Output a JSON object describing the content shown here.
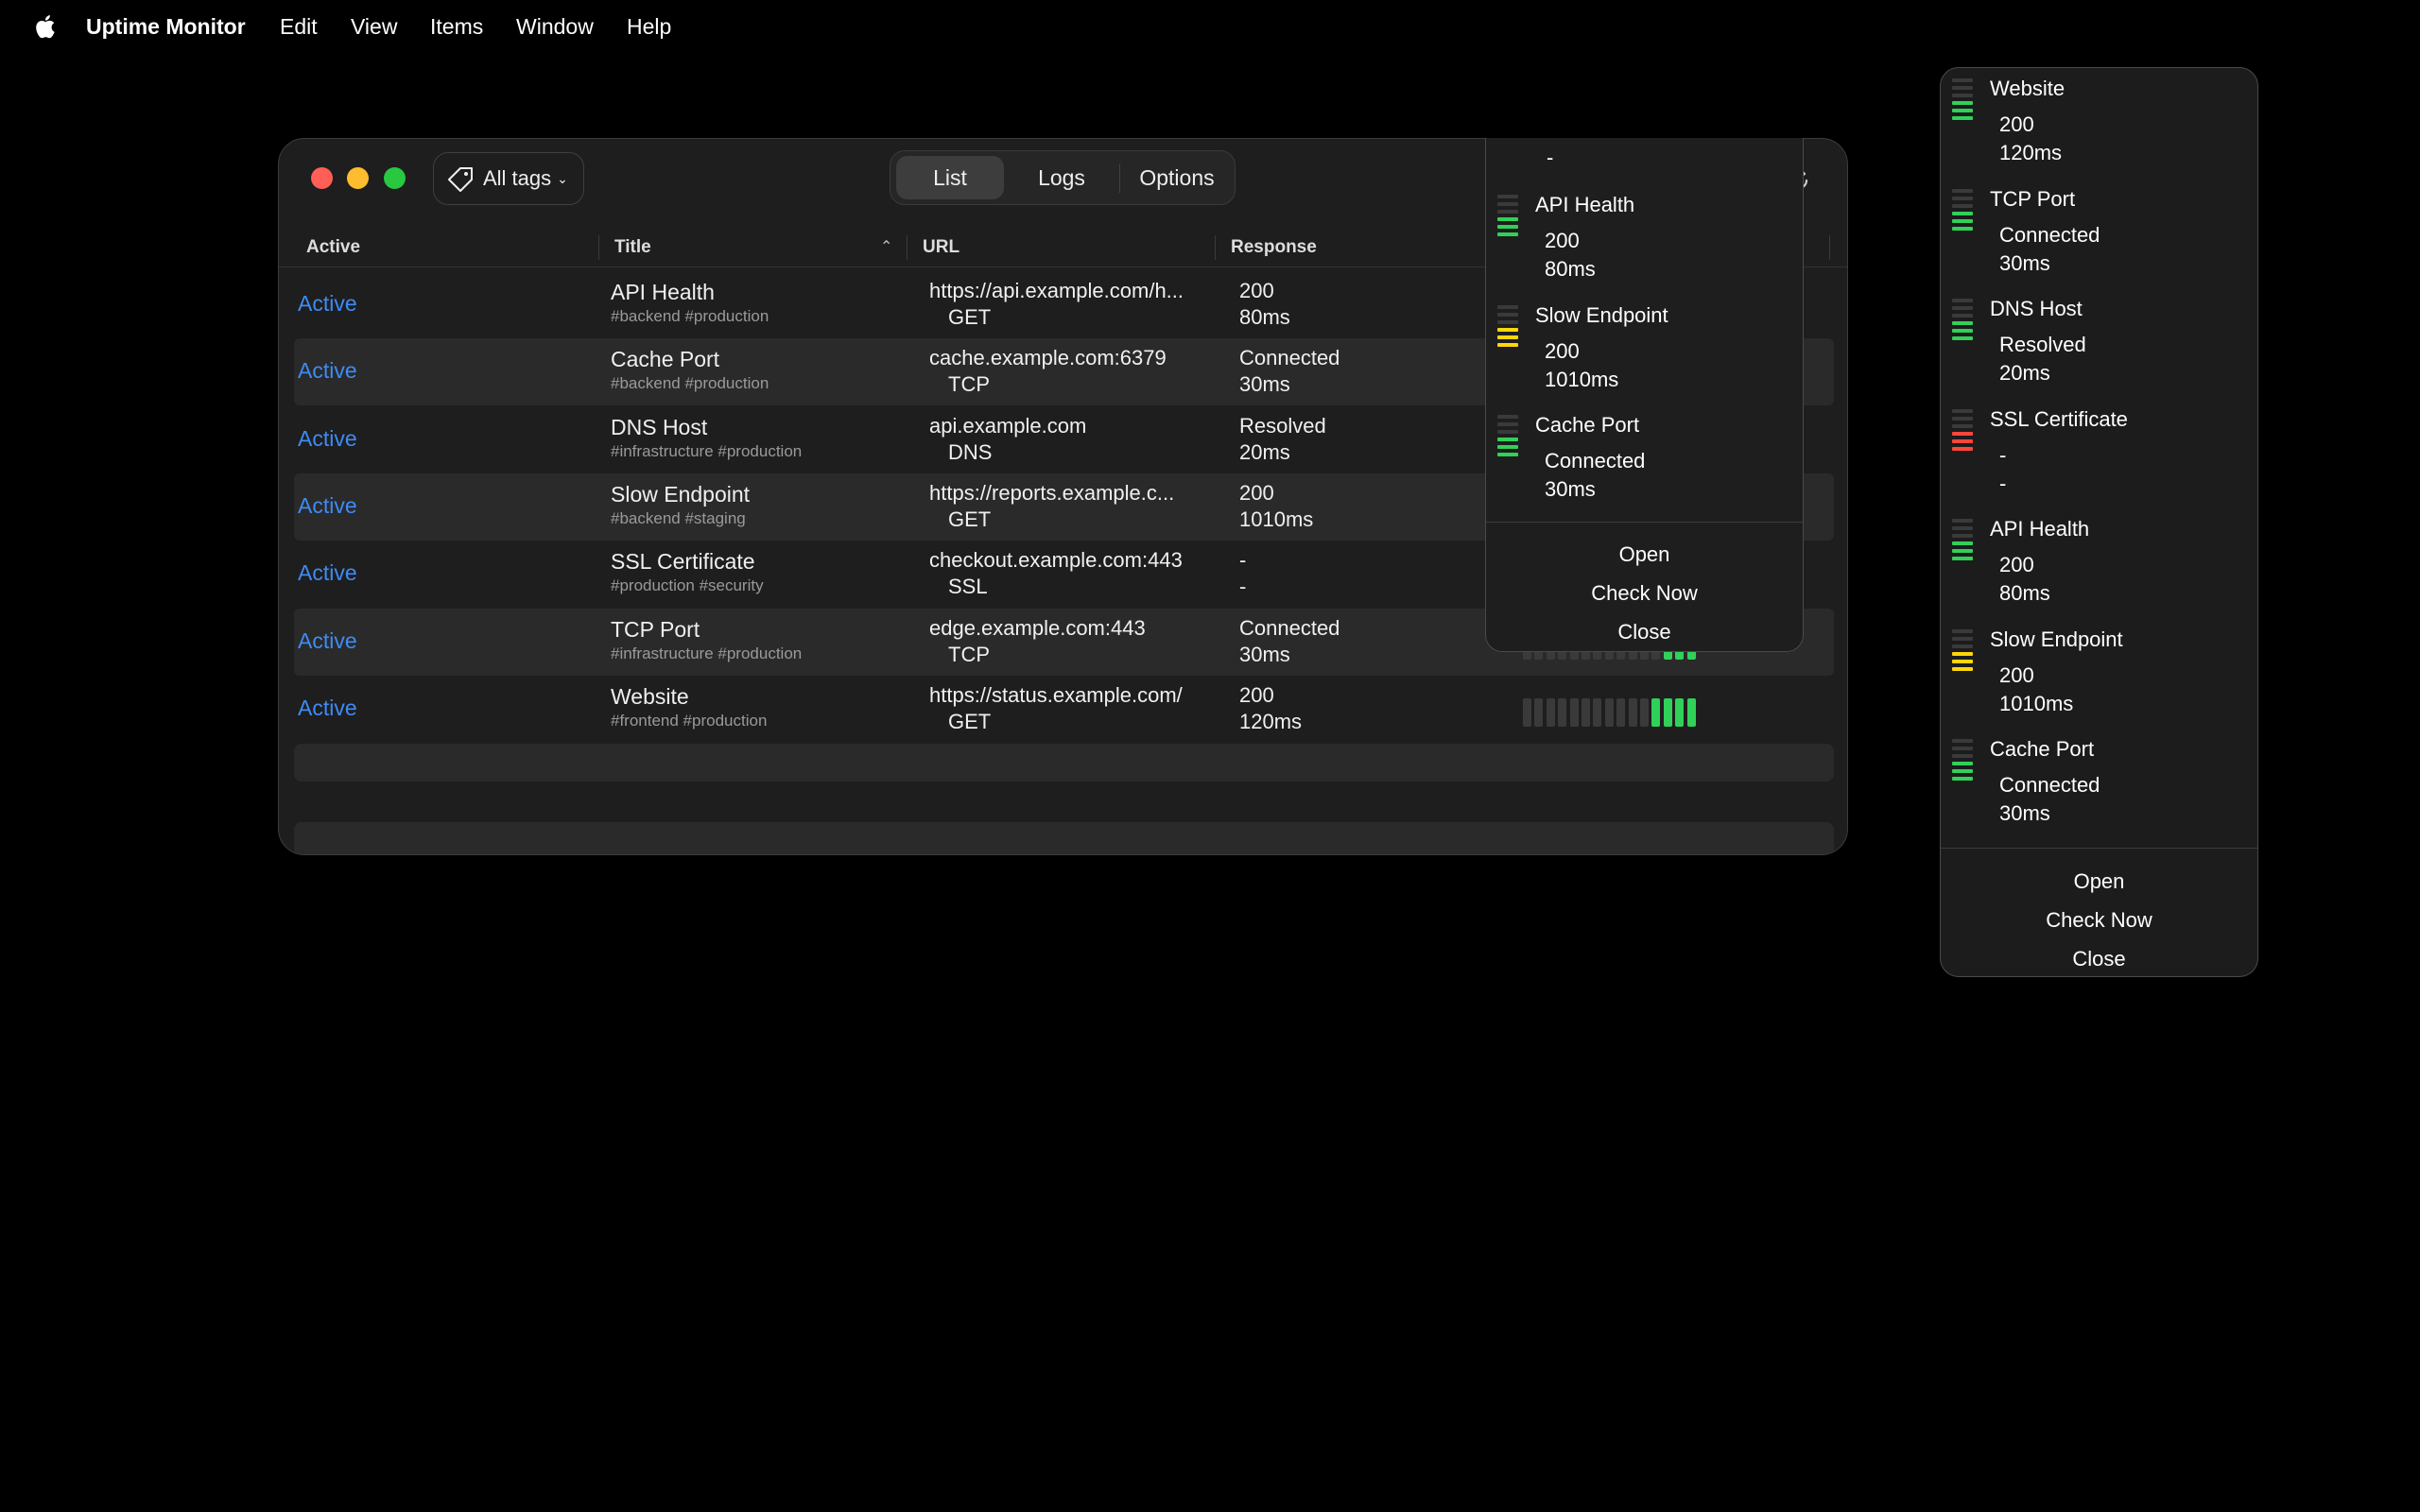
{
  "menubar": {
    "app_name": "Uptime Monitor",
    "items": [
      "Edit",
      "View",
      "Items",
      "Window",
      "Help"
    ]
  },
  "toolbar": {
    "tag_filter": "All tags",
    "segments": [
      "List",
      "Logs",
      "Options"
    ],
    "selected_segment": "List"
  },
  "table": {
    "columns": [
      "Active",
      "Title",
      "URL",
      "Response"
    ],
    "rows": [
      {
        "active": "Active",
        "title": "API Health",
        "tags": "#backend #production",
        "url": "https://api.example.com/h...",
        "method": "GET",
        "status": "200",
        "time": "80ms",
        "history": "ggggggggggggggg"
      },
      {
        "active": "Active",
        "title": "Cache Port",
        "tags": "#backend #production",
        "url": "cache.example.com:6379",
        "method": "TCP",
        "status": "Connected",
        "time": "30ms",
        "history": "ggggggggggggggg"
      },
      {
        "active": "Active",
        "title": "DNS Host",
        "tags": "#infrastructure #production",
        "url": "api.example.com",
        "method": "DNS",
        "status": "Resolved",
        "time": "20ms",
        "history": "ggggggggggggggg"
      },
      {
        "active": "Active",
        "title": "Slow Endpoint",
        "tags": "#backend #staging",
        "url": "https://reports.example.c...",
        "method": "GET",
        "status": "200",
        "time": "1010ms",
        "history": "yyyyyyyyyyyyyyy"
      },
      {
        "active": "Active",
        "title": "SSL Certificate",
        "tags": "#production #security",
        "url": "checkout.example.com:443",
        "method": "SSL",
        "status": "-",
        "time": "-",
        "history": "rrrrrrrrrrrrrrr"
      },
      {
        "active": "Active",
        "title": "TCP Port",
        "tags": "#infrastructure #production",
        "url": "edge.example.com:443",
        "method": "TCP",
        "status": "Connected",
        "time": "30ms",
        "history": "eeeeeeeeeeeeggg"
      },
      {
        "active": "Active",
        "title": "Website",
        "tags": "#frontend #production",
        "url": "https://status.example.com/",
        "method": "GET",
        "status": "200",
        "time": "120ms",
        "history": "eeeeeeeeeeegggg"
      }
    ]
  },
  "window_popup": {
    "partial_top_value": "-",
    "items": [
      {
        "title": "API Health",
        "status": "200",
        "time": "80ms",
        "color": "#30d158"
      },
      {
        "title": "Slow Endpoint",
        "status": "200",
        "time": "1010ms",
        "color": "#ffd60a"
      },
      {
        "title": "Cache Port",
        "status": "Connected",
        "time": "30ms",
        "color": "#30d158"
      }
    ],
    "actions": [
      "Open",
      "Check Now",
      "Close"
    ]
  },
  "statusbar_popup": {
    "items": [
      {
        "title": "Website",
        "status": "200",
        "time": "120ms",
        "color": "#30d158"
      },
      {
        "title": "TCP Port",
        "status": "Connected",
        "time": "30ms",
        "color": "#30d158"
      },
      {
        "title": "DNS Host",
        "status": "Resolved",
        "time": "20ms",
        "color": "#30d158"
      },
      {
        "title": "SSL Certificate",
        "status": "-",
        "time": "-",
        "color": "#ff453a"
      },
      {
        "title": "API Health",
        "status": "200",
        "time": "80ms",
        "color": "#30d158"
      },
      {
        "title": "Slow Endpoint",
        "status": "200",
        "time": "1010ms",
        "color": "#ffd60a"
      },
      {
        "title": "Cache Port",
        "status": "Connected",
        "time": "30ms",
        "color": "#30d158"
      }
    ],
    "actions": [
      "Open",
      "Check Now",
      "Close"
    ]
  },
  "colors": {
    "up": "#30d158",
    "slow": "#ffd60a",
    "down": "#ff453a",
    "inactive": "#3a3a3a",
    "link": "#3e8bf5"
  }
}
